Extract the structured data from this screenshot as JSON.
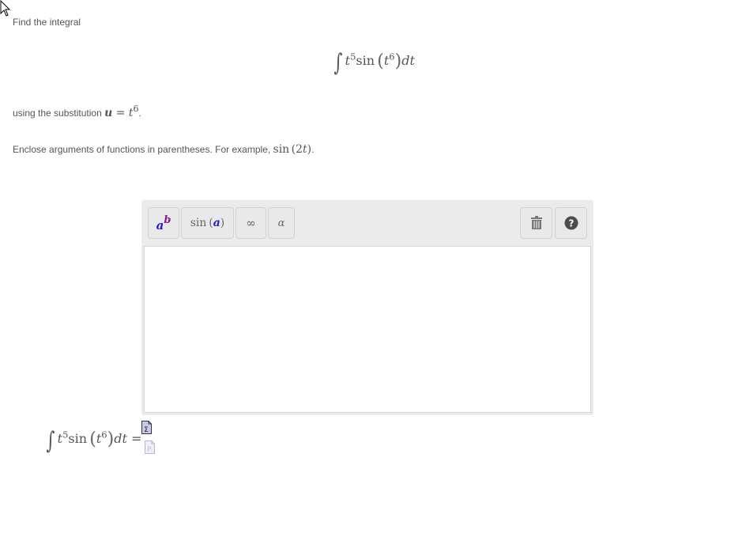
{
  "question": {
    "prompt": "Find the integral",
    "integral": {
      "integral_sign": "∫",
      "base1": "t",
      "exp1": "5",
      "func": "sin",
      "open_paren": "(",
      "base2": "t",
      "exp2": "6",
      "close_paren": ")",
      "differential": "dt"
    },
    "substitution_text": "using the substitution ",
    "substitution_var": "u",
    "substitution_eq": " = ",
    "substitution_base": "t",
    "substitution_exp": "6",
    "substitution_end": ".",
    "instruction_text": "Enclose arguments of functions in parentheses. For example, ",
    "instruction_example_func": "sin",
    "instruction_example_arg": "(2",
    "instruction_example_var": "t",
    "instruction_example_close": ")",
    "instruction_end": "."
  },
  "editor": {
    "toolbar": {
      "power_button": {
        "base": "a",
        "exp": "b",
        "base_color": "#1a1adb",
        "exp_color": "#8b1a8b"
      },
      "function_button": {
        "func": "sin",
        "open": "(",
        "arg": "a",
        "close": ")",
        "arg_color": "#1a1adb"
      },
      "infinity_button": {
        "label": "∞"
      },
      "greek_button": {
        "label": "α"
      },
      "trash_button": {
        "icon": "trash-icon"
      },
      "help_button": {
        "icon": "question-icon",
        "label": "?"
      }
    },
    "input_value": ""
  },
  "answer_row": {
    "integral_sign": "∫",
    "base1": "t",
    "exp1": "5",
    "func": "sin",
    "open_paren": "(",
    "base2": "t",
    "exp2": "6",
    "close_paren": ")",
    "differential": "dt",
    "equals": " ="
  }
}
